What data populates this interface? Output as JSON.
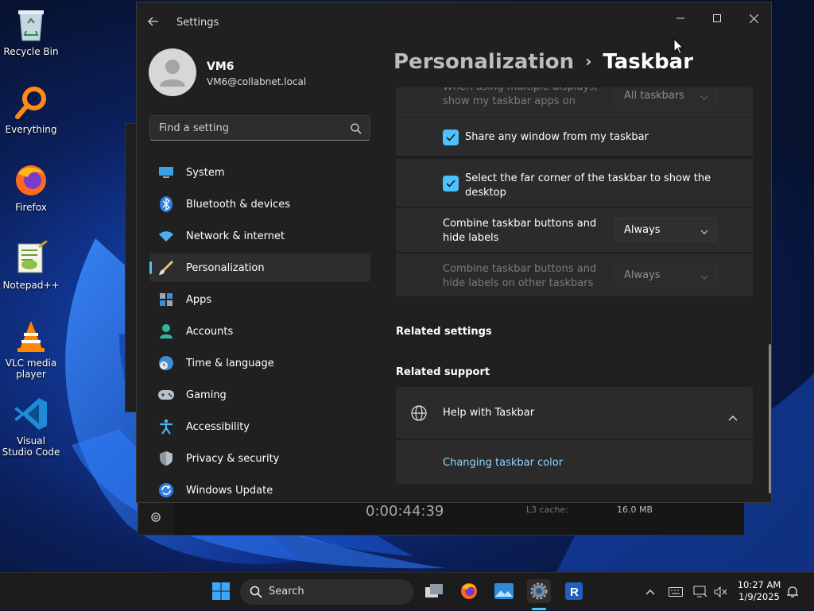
{
  "desktop": {
    "icons": [
      {
        "label": "Recycle Bin"
      },
      {
        "label": "Everything"
      },
      {
        "label": "Firefox"
      },
      {
        "label": "Notepad++"
      },
      {
        "label": "VLC media player"
      },
      {
        "label": "Visual Studio Code"
      }
    ]
  },
  "window": {
    "title": "Settings",
    "controls": {
      "minimize": "—",
      "maximize": "☐",
      "close": "✕"
    }
  },
  "user": {
    "name": "VM6",
    "email": "VM6@collabnet.local"
  },
  "search": {
    "placeholder": "Find a setting"
  },
  "nav": {
    "items": [
      {
        "label": "System",
        "icon": "monitor-icon"
      },
      {
        "label": "Bluetooth & devices",
        "icon": "bluetooth-icon"
      },
      {
        "label": "Network & internet",
        "icon": "wifi-icon"
      },
      {
        "label": "Personalization",
        "icon": "brush-icon",
        "active": true
      },
      {
        "label": "Apps",
        "icon": "apps-icon"
      },
      {
        "label": "Accounts",
        "icon": "person-icon"
      },
      {
        "label": "Time & language",
        "icon": "globe-clock-icon"
      },
      {
        "label": "Gaming",
        "icon": "controller-icon"
      },
      {
        "label": "Accessibility",
        "icon": "accessibility-icon"
      },
      {
        "label": "Privacy & security",
        "icon": "shield-icon"
      },
      {
        "label": "Windows Update",
        "icon": "update-icon"
      }
    ]
  },
  "breadcrumb": {
    "parent": "Personalization",
    "separator": "›",
    "current": "Taskbar"
  },
  "settings": {
    "multi_display_label": "When using multiple displays, show my taskbar apps on",
    "multi_display_value": "All taskbars",
    "share_window_label": "Share any window from my taskbar",
    "far_corner_label": "Select the far corner of the taskbar to show the desktop",
    "combine_label": "Combine taskbar buttons and hide labels",
    "combine_value": "Always",
    "combine_other_label": "Combine taskbar buttons and hide labels on other taskbars",
    "combine_other_value": "Always"
  },
  "related_settings": {
    "title": "Related settings"
  },
  "related_support": {
    "title": "Related support",
    "help_label": "Help with Taskbar",
    "link_label": "Changing taskbar color"
  },
  "background_app": {
    "timer": "0:00:44:39",
    "cache_label": "L3 cache:",
    "cache_value": "16.0 MB"
  },
  "taskbar": {
    "search_label": "Search",
    "time": "10:27 AM",
    "date": "1/9/2025"
  },
  "colors": {
    "accent": "#4cc2ff",
    "window_bg": "#202020",
    "card_bg": "#2b2b2b"
  }
}
